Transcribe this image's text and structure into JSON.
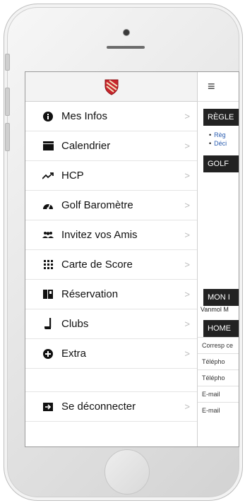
{
  "menu": {
    "items": [
      {
        "label": "Mes Infos",
        "icon": "info-icon"
      },
      {
        "label": "Calendrier",
        "icon": "calendar-icon"
      },
      {
        "label": "HCP",
        "icon": "trend-icon"
      },
      {
        "label": "Golf Baromètre",
        "icon": "gauge-icon"
      },
      {
        "label": "Invitez vos Amis",
        "icon": "users-icon"
      },
      {
        "label": "Carte de Score",
        "icon": "grid-icon"
      },
      {
        "label": "Réservation",
        "icon": "book-icon"
      },
      {
        "label": "Clubs",
        "icon": "golf-club-icon"
      },
      {
        "label": "Extra",
        "icon": "plus-circle-icon"
      }
    ],
    "logout": {
      "label": "Se déconnecter",
      "icon": "logout-icon"
    },
    "chevron": ">"
  },
  "content": {
    "menu_toggle": "≡",
    "section_rules": "RÈGLE",
    "links": [
      "Règ",
      "Déci"
    ],
    "section_golf": "GOLF",
    "section_mon": "MON I",
    "name_text": "Vanmol M",
    "section_home": "HOME",
    "rows": [
      "Corresp ce",
      "Télépho",
      "Télépho",
      "E-mail",
      "E-mail"
    ]
  },
  "colors": {
    "brand_red": "#c8252c",
    "header_dark": "#222222",
    "link_blue": "#2a5db0"
  }
}
